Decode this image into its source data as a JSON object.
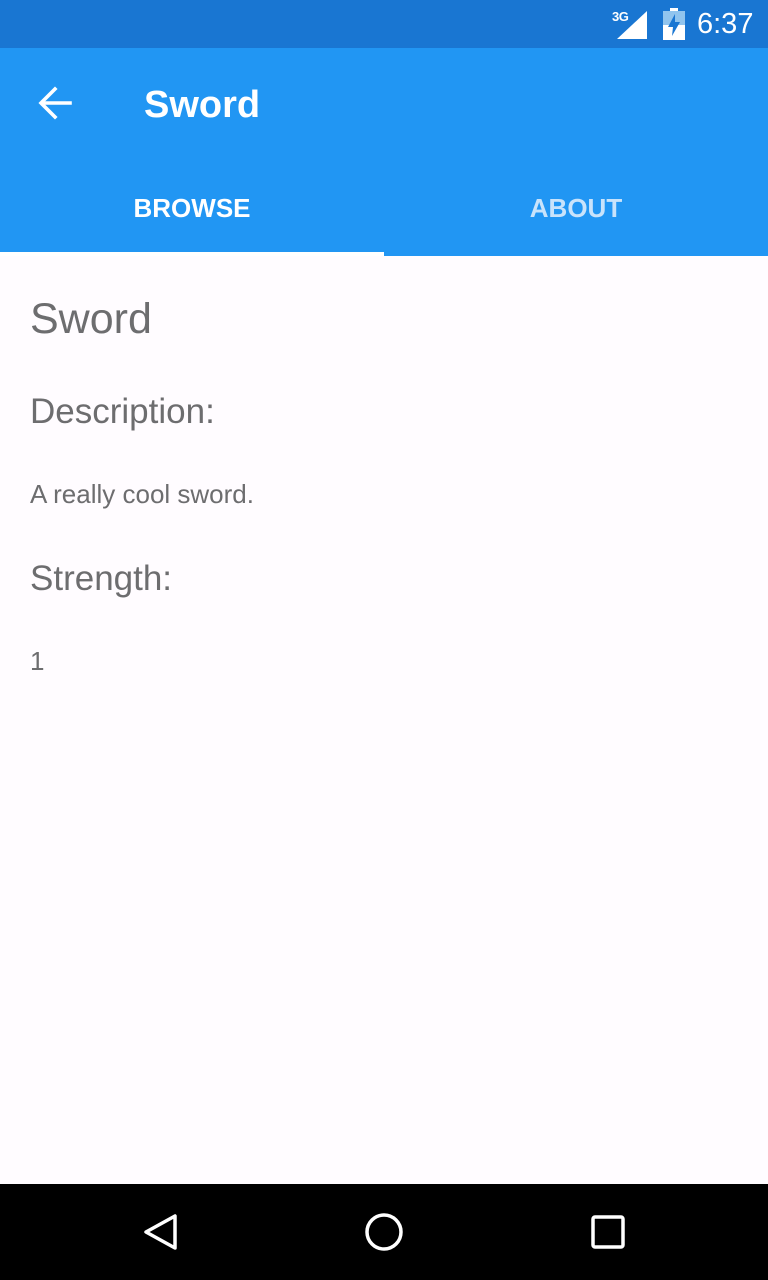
{
  "status_bar": {
    "network": "3G",
    "time": "6:37",
    "icons": [
      "signal-icon",
      "battery-icon"
    ]
  },
  "app_bar": {
    "title": "Sword",
    "back_icon": "arrow-back-icon",
    "background_color": "#2196f3",
    "status_color": "#1976d2"
  },
  "tabs": [
    {
      "label": "BROWSE",
      "selected": true
    },
    {
      "label": "ABOUT",
      "selected": false
    }
  ],
  "item": {
    "name": "Sword",
    "description_label": "Description:",
    "description": "A really cool sword.",
    "strength_label": "Strength:",
    "strength": "1"
  },
  "nav_bar": {
    "buttons": [
      "back-triangle-icon",
      "home-circle-icon",
      "recents-square-icon"
    ]
  }
}
